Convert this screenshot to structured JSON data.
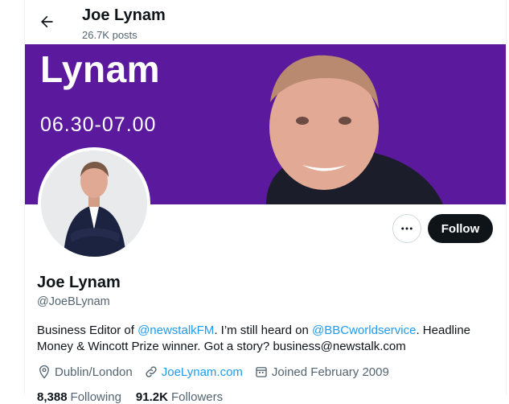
{
  "header": {
    "name": "Joe Lynam",
    "posts": "26.7K posts"
  },
  "banner": {
    "title": "Lynam",
    "time": "06.30-07.00"
  },
  "actions": {
    "follow_label": "Follow"
  },
  "profile": {
    "name": "Joe Lynam",
    "handle": "@JoeBLynam",
    "bio_prefix": "Business Editor of ",
    "bio_mention1": "@newstalkFM",
    "bio_middle": ". I’m still heard on ",
    "bio_mention2": "@BBCworldservice",
    "bio_suffix": ". Headline Money & Wincott Prize winner. Got a story? business@newstalk.com",
    "location": "Dublin/London",
    "website": "JoeLynam.com",
    "joined": "Joined February 2009",
    "following_count": "8,388",
    "following_label": "Following",
    "followers_count": "91.2K",
    "followers_label": "Followers"
  },
  "colors": {
    "accent": "#1d9bf0",
    "banner": "#5b1a9d",
    "text": "#0f1419",
    "muted": "#536471"
  }
}
